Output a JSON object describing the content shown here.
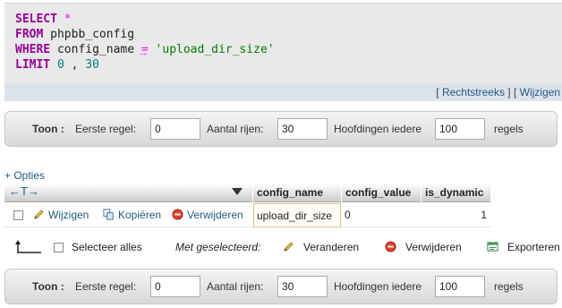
{
  "sql": {
    "line1": {
      "kw": "SELECT",
      "rest": " *"
    },
    "line2": {
      "kw": "FROM",
      "rest": " phpbb_config"
    },
    "line3": {
      "kw": "WHERE",
      "col": " config_name ",
      "op": "=",
      "str": " 'upload_dir_size'"
    },
    "line4": {
      "kw": "LIMIT",
      "num1": " 0",
      "sep": " , ",
      "num2": "30"
    },
    "links": {
      "open": "[ ",
      "rechtstreeks": "Rechtstreeks",
      "mid": " ] [ ",
      "wijzigen": "Wijzigen"
    }
  },
  "nav": {
    "toon": "Toon :",
    "eerste_regel": "Eerste regel:",
    "eerste_regel_value": "0",
    "aantal_rijen": "Aantal rijen:",
    "aantal_rijen_value": "30",
    "hoofdingen_iedere": "Hoofdingen iedere",
    "hoofdingen_value": "100",
    "regels": "regels"
  },
  "options": {
    "label": "+ Opties",
    "arrows": "←T→"
  },
  "table": {
    "headers": [
      "config_name",
      "config_value",
      "is_dynamic"
    ],
    "row": {
      "edit": "Wijzigen",
      "copy": "Kopiëren",
      "delete": "Verwijderen",
      "config_name": "upload_dir_size",
      "config_value": "0",
      "is_dynamic": "1"
    }
  },
  "bulk": {
    "select_all": "Selecteer alles",
    "with_selected": "Met geselecteerd:",
    "change": "Veranderen",
    "delete": "Verwijderen",
    "export": "Exporteren"
  },
  "colors": {
    "keyword": "#990099",
    "string": "#008000",
    "number": "#008080",
    "link": "#235a81"
  }
}
